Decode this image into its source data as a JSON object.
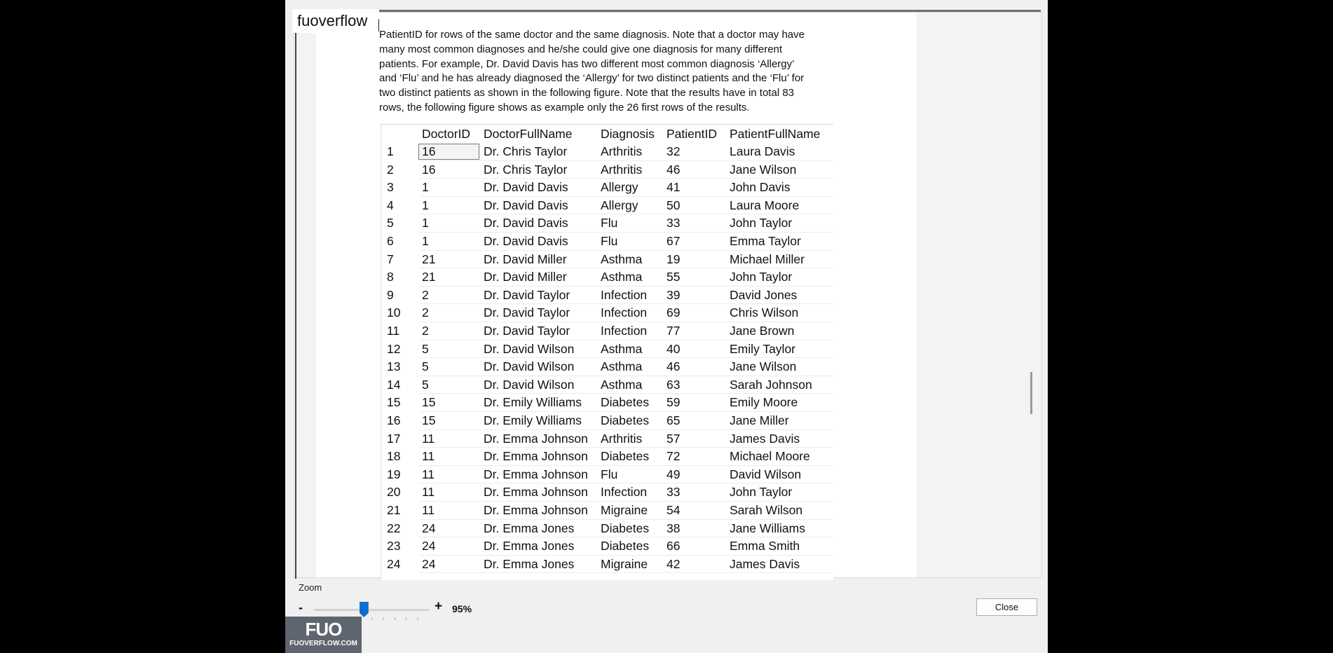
{
  "watermark": "fuoverflow",
  "paragraph_lines": [
    "PatientID for rows of the same doctor and the same diagnosis. Note that a doctor may have",
    "many most common diagnoses and he/she could give one diagnosis for many different",
    "patients. For example, Dr. David Davis has two different most common diagnosis ‘Allergy’",
    "and ‘Flu’ and he has already diagnosed the ‘Allergy’ for two distinct patients and the ‘Flu’ for",
    "two distinct patients as shown in the following figure. Note that the results have in total 83",
    "rows, the following figure shows as example only the 26 first rows of the results."
  ],
  "table": {
    "columns": [
      "DoctorID",
      "DoctorFullName",
      "Diagnosis",
      "PatientID",
      "PatientFullName"
    ],
    "rows": [
      [
        "1",
        "16",
        "Dr. Chris Taylor",
        "Arthritis",
        "32",
        "Laura Davis"
      ],
      [
        "2",
        "16",
        "Dr. Chris Taylor",
        "Arthritis",
        "46",
        "Jane Wilson"
      ],
      [
        "3",
        "1",
        "Dr. David Davis",
        "Allergy",
        "41",
        "John Davis"
      ],
      [
        "4",
        "1",
        "Dr. David Davis",
        "Allergy",
        "50",
        "Laura Moore"
      ],
      [
        "5",
        "1",
        "Dr. David Davis",
        "Flu",
        "33",
        "John Taylor"
      ],
      [
        "6",
        "1",
        "Dr. David Davis",
        "Flu",
        "67",
        "Emma Taylor"
      ],
      [
        "7",
        "21",
        "Dr. David Miller",
        "Asthma",
        "19",
        "Michael Miller"
      ],
      [
        "8",
        "21",
        "Dr. David Miller",
        "Asthma",
        "55",
        "John Taylor"
      ],
      [
        "9",
        "2",
        "Dr. David Taylor",
        "Infection",
        "39",
        "David Jones"
      ],
      [
        "10",
        "2",
        "Dr. David Taylor",
        "Infection",
        "69",
        "Chris Wilson"
      ],
      [
        "11",
        "2",
        "Dr. David Taylor",
        "Infection",
        "77",
        "Jane Brown"
      ],
      [
        "12",
        "5",
        "Dr. David Wilson",
        "Asthma",
        "40",
        "Emily Taylor"
      ],
      [
        "13",
        "5",
        "Dr. David Wilson",
        "Asthma",
        "46",
        "Jane Wilson"
      ],
      [
        "14",
        "5",
        "Dr. David Wilson",
        "Asthma",
        "63",
        "Sarah Johnson"
      ],
      [
        "15",
        "15",
        "Dr. Emily Williams",
        "Diabetes",
        "59",
        "Emily Moore"
      ],
      [
        "16",
        "15",
        "Dr. Emily Williams",
        "Diabetes",
        "65",
        "Jane Miller"
      ],
      [
        "17",
        "11",
        "Dr. Emma Johnson",
        "Arthritis",
        "57",
        "James Davis"
      ],
      [
        "18",
        "11",
        "Dr. Emma Johnson",
        "Diabetes",
        "72",
        "Michael Moore"
      ],
      [
        "19",
        "11",
        "Dr. Emma Johnson",
        "Flu",
        "49",
        "David Wilson"
      ],
      [
        "20",
        "11",
        "Dr. Emma Johnson",
        "Infection",
        "33",
        "John Taylor"
      ],
      [
        "21",
        "11",
        "Dr. Emma Johnson",
        "Migraine",
        "54",
        "Sarah Wilson"
      ],
      [
        "22",
        "24",
        "Dr. Emma Jones",
        "Diabetes",
        "38",
        "Jane Williams"
      ],
      [
        "23",
        "24",
        "Dr. Emma Jones",
        "Diabetes",
        "66",
        "Emma Smith"
      ],
      [
        "24",
        "24",
        "Dr. Emma Jones",
        "Migraine",
        "42",
        "James Davis"
      ]
    ]
  },
  "zoom": {
    "label": "Zoom",
    "minus": "-",
    "plus": "+",
    "value_text": "95%",
    "value": 0.95
  },
  "close_label": "Close",
  "logo": {
    "mark": "FUO",
    "url": "FUOVERFLOW.COM"
  },
  "colors": {
    "slider_thumb": "#0a6fd1",
    "logo_bg": "#5e6470"
  }
}
